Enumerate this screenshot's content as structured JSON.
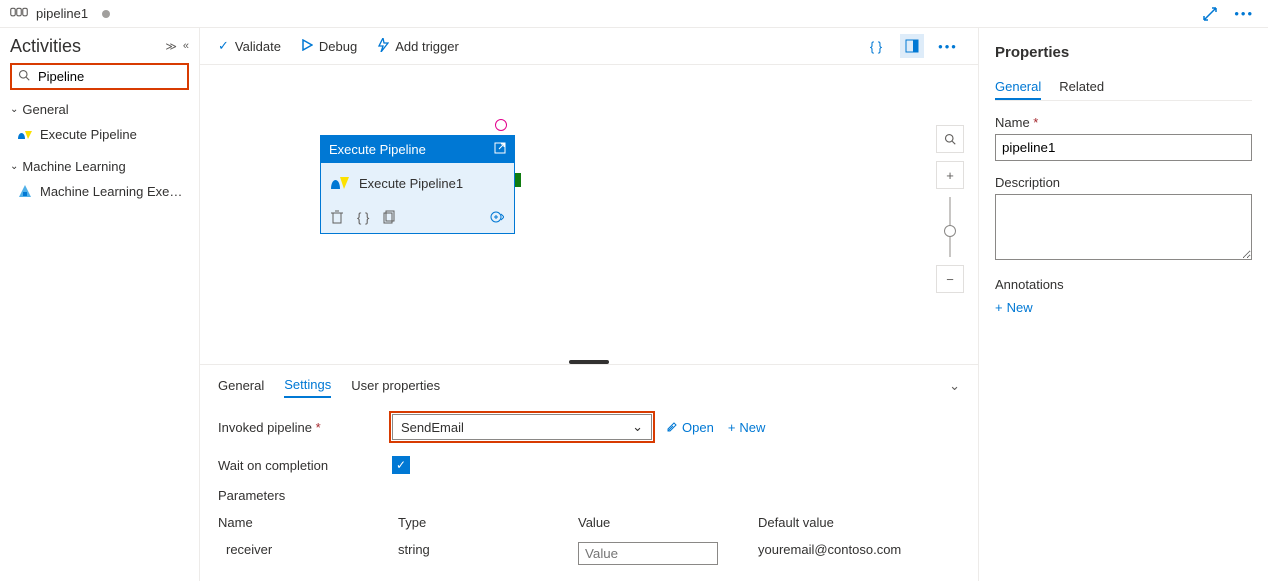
{
  "tab": {
    "name": "pipeline1"
  },
  "sidebar": {
    "title": "Activities",
    "search_value": "Pipeline",
    "groups": [
      {
        "label": "General",
        "items": [
          {
            "label": "Execute Pipeline"
          }
        ]
      },
      {
        "label": "Machine Learning",
        "items": [
          {
            "label": "Machine Learning Exe…"
          }
        ]
      }
    ]
  },
  "toolbar": {
    "validate": "Validate",
    "debug": "Debug",
    "add_trigger": "Add trigger"
  },
  "node": {
    "type": "Execute Pipeline",
    "title": "Execute Pipeline1"
  },
  "bottom": {
    "tabs": {
      "general": "General",
      "settings": "Settings",
      "user_props": "User properties"
    },
    "invoked_label": "Invoked pipeline",
    "invoked_value": "SendEmail",
    "open": "Open",
    "new": "New",
    "wait_label": "Wait on completion",
    "parameters_label": "Parameters",
    "columns": {
      "name": "Name",
      "type": "Type",
      "value": "Value",
      "default": "Default value"
    },
    "param_rows": [
      {
        "name": "receiver",
        "type": "string",
        "value_placeholder": "Value",
        "default": "youremail@contoso.com"
      }
    ]
  },
  "properties": {
    "title": "Properties",
    "tabs": {
      "general": "General",
      "related": "Related"
    },
    "name_label": "Name",
    "name_value": "pipeline1",
    "desc_label": "Description",
    "annotations_label": "Annotations",
    "new_annotation": "New"
  }
}
